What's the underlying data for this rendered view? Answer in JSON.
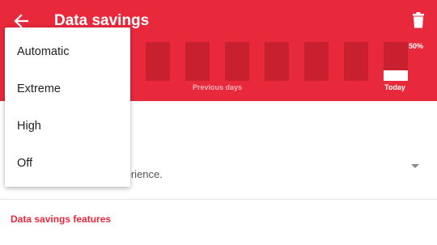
{
  "header": {
    "title": "Data savings",
    "back_icon": "arrow-back-icon",
    "trash_icon": "trash-icon",
    "accent_color": "#e8283b"
  },
  "usage_chart": {
    "today_percent_label": "50%",
    "today_fill_fraction": 0.27,
    "previous_days_label": "Previous days",
    "today_label": "Today",
    "previous_days_bar_count": 7
  },
  "setting": {
    "description_visible": "ings for optimal user experience."
  },
  "features": {
    "label": "Data savings features"
  },
  "menu": {
    "items": [
      "Automatic",
      "Extreme",
      "High",
      "Off"
    ]
  }
}
